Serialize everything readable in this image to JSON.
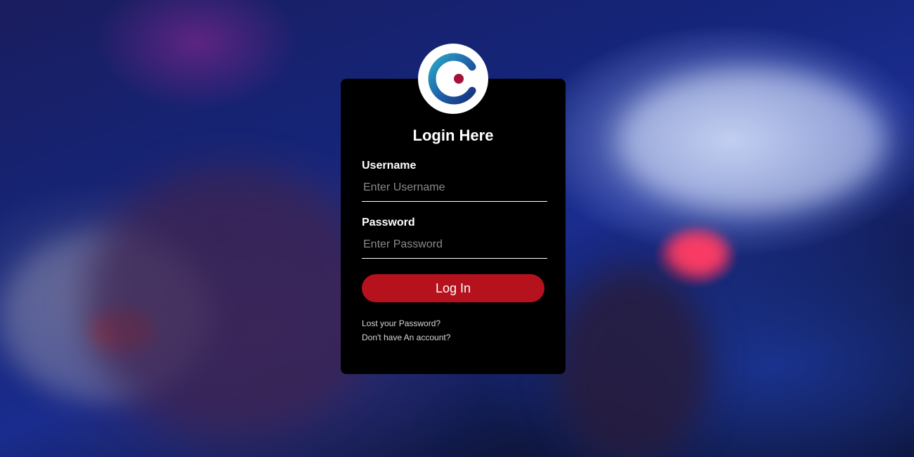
{
  "login": {
    "title": "Login Here",
    "username_label": "Username",
    "username_placeholder": "Enter Username",
    "username_value": "",
    "password_label": "Password",
    "password_placeholder": "Enter Password",
    "password_value": "",
    "submit_label": "Log In",
    "lost_password_link": "Lost your Password?",
    "signup_link": "Don't have An account?"
  },
  "logo": {
    "icon": "brand-c-logo-icon"
  },
  "colors": {
    "card_background": "#000000",
    "button_accent": "#b5121e",
    "logo_blue": "#1f5fa8",
    "logo_teal": "#2aa7c4",
    "logo_dot": "#a3123a"
  }
}
